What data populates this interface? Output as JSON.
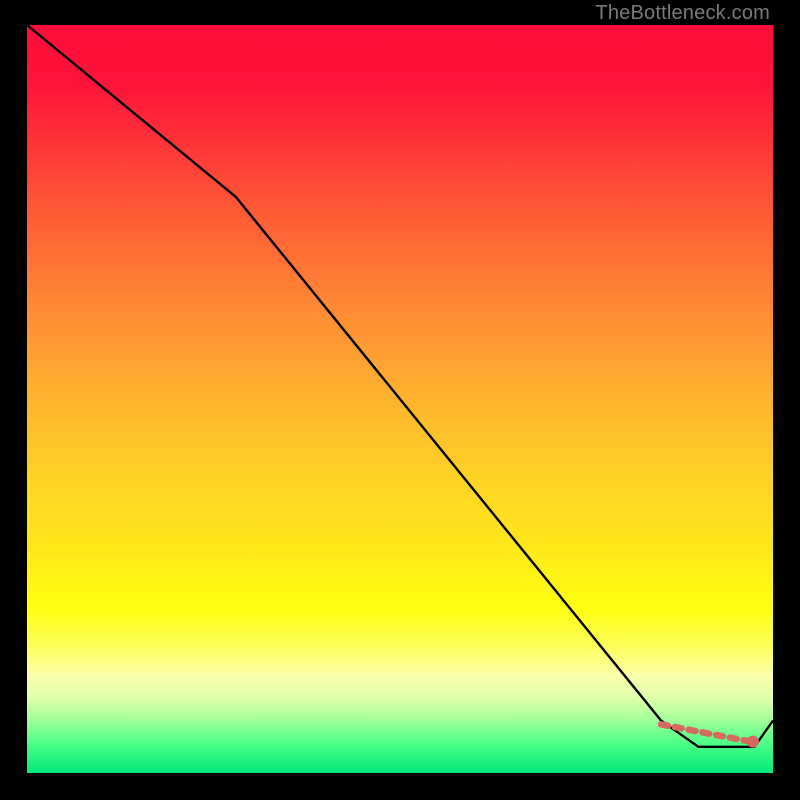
{
  "watermark": "TheBottleneck.com",
  "colors": {
    "line": "#000000",
    "dashed": "#d6695e",
    "dot": "#d6695e"
  },
  "chart_data": {
    "type": "line",
    "title": "",
    "xlabel": "",
    "ylabel": "",
    "xlim": [
      0,
      100
    ],
    "ylim": [
      0,
      100
    ],
    "series": [
      {
        "name": "main-curve",
        "x": [
          0,
          28,
          85,
          90,
          97.5,
          100
        ],
        "y": [
          100,
          77,
          7,
          3.5,
          3.5,
          7
        ]
      },
      {
        "name": "dashed-segment",
        "x": [
          85,
          97
        ],
        "y": [
          6.5,
          4.2
        ]
      }
    ],
    "points": [
      {
        "name": "min-dot",
        "x": 97.3,
        "y": 4.2
      }
    ]
  }
}
